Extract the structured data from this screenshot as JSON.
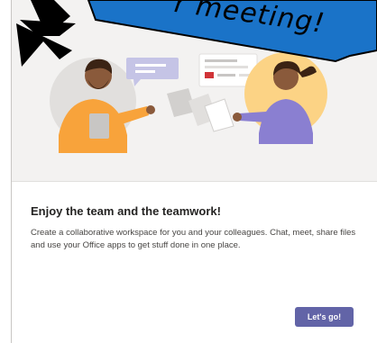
{
  "dialog": {
    "title": "Enjoy the team and the teamwork!",
    "description": "Create a collaborative workspace for you and your colleagues. Chat, meet, share files and use your Office apps to get stuff done in one place.",
    "primary_button_label": "Let's go!"
  },
  "annotation": {
    "banner_text": "r meeting!",
    "arrow_icon": "arrow-down-left-icon"
  },
  "colors": {
    "accent": "#6264a7",
    "banner_blue": "#1a73c8",
    "hero_background": "#f3f2f1"
  }
}
